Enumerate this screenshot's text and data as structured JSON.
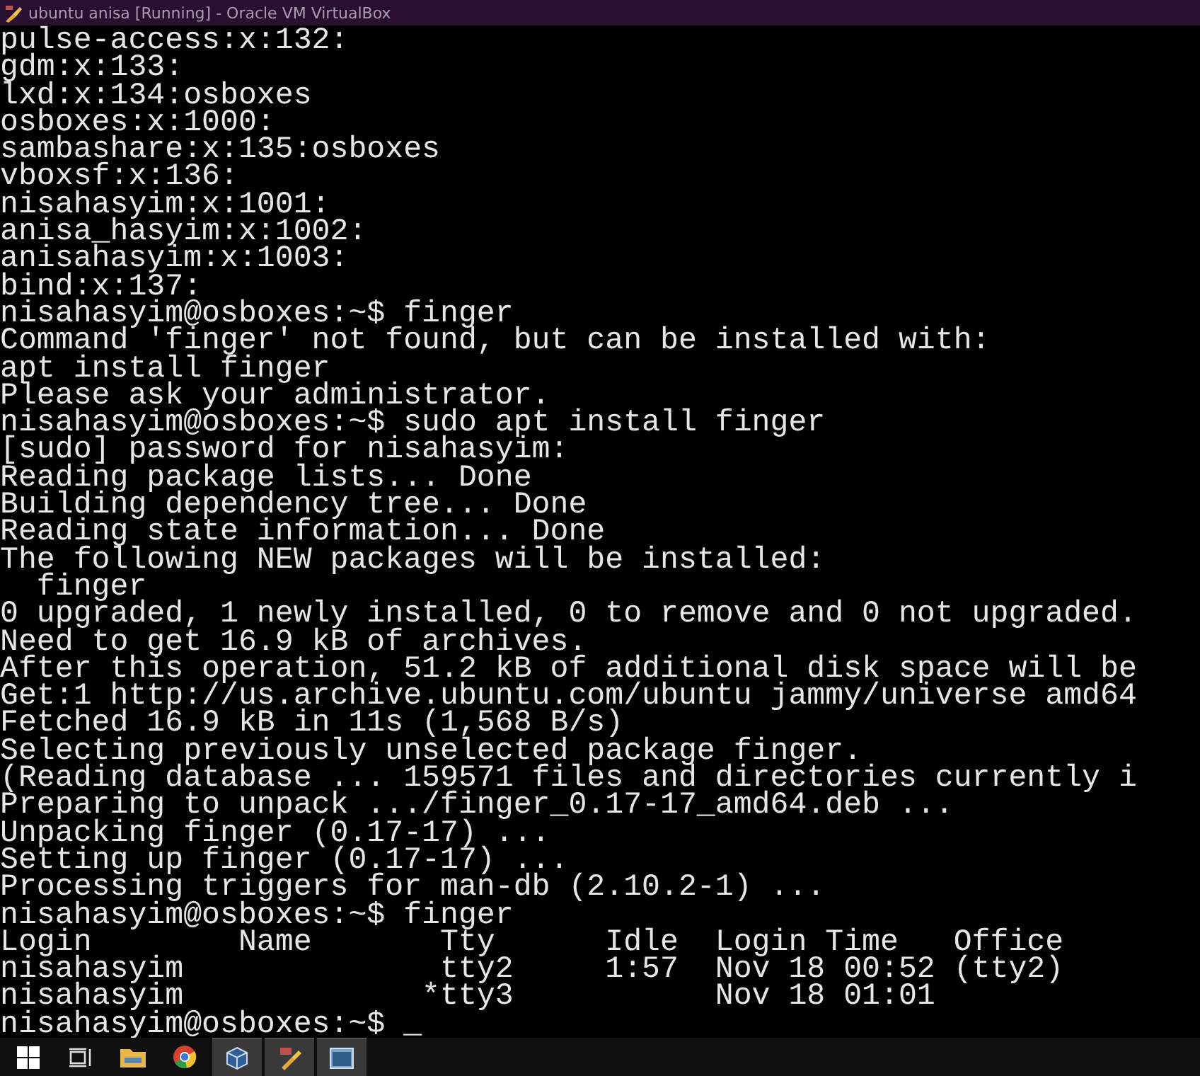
{
  "window": {
    "title": "ubuntu anisa [Running] - Oracle VM VirtualBox"
  },
  "terminal": {
    "lines": [
      "pulse-access:x:132:",
      "gdm:x:133:",
      "lxd:x:134:osboxes",
      "osboxes:x:1000:",
      "sambashare:x:135:osboxes",
      "vboxsf:x:136:",
      "nisahasyim:x:1001:",
      "anisa_hasyim:x:1002:",
      "anisahasyim:x:1003:",
      "bind:x:137:",
      "nisahasyim@osboxes:~$ finger",
      "Command 'finger' not found, but can be installed with:",
      "apt install finger",
      "Please ask your administrator.",
      "nisahasyim@osboxes:~$ sudo apt install finger",
      "[sudo] password for nisahasyim:",
      "Reading package lists... Done",
      "Building dependency tree... Done",
      "Reading state information... Done",
      "The following NEW packages will be installed:",
      "  finger",
      "0 upgraded, 1 newly installed, 0 to remove and 0 not upgraded.",
      "Need to get 16.9 kB of archives.",
      "After this operation, 51.2 kB of additional disk space will be",
      "Get:1 http://us.archive.ubuntu.com/ubuntu jammy/universe amd64",
      "Fetched 16.9 kB in 11s (1,568 B/s)",
      "Selecting previously unselected package finger.",
      "(Reading database ... 159571 files and directories currently i",
      "Preparing to unpack .../finger_0.17-17_amd64.deb ...",
      "Unpacking finger (0.17-17) ...",
      "Setting up finger (0.17-17) ...",
      "Processing triggers for man-db (2.10.2-1) ...",
      "nisahasyim@osboxes:~$ finger",
      "Login        Name       Tty      Idle  Login Time   Office",
      "nisahasyim              tty2     1:57  Nov 18 00:52 (tty2)",
      "nisahasyim             *tty3           Nov 18 01:01",
      "nisahasyim@osboxes:~$ _"
    ]
  },
  "taskbar": {
    "items": [
      {
        "kind": "start",
        "running": false
      },
      {
        "kind": "taskview",
        "running": false
      },
      {
        "kind": "folder",
        "running": false
      },
      {
        "kind": "browser",
        "running": false
      },
      {
        "kind": "cube",
        "running": true
      },
      {
        "kind": "tools",
        "running": true
      },
      {
        "kind": "window",
        "running": true
      }
    ]
  }
}
